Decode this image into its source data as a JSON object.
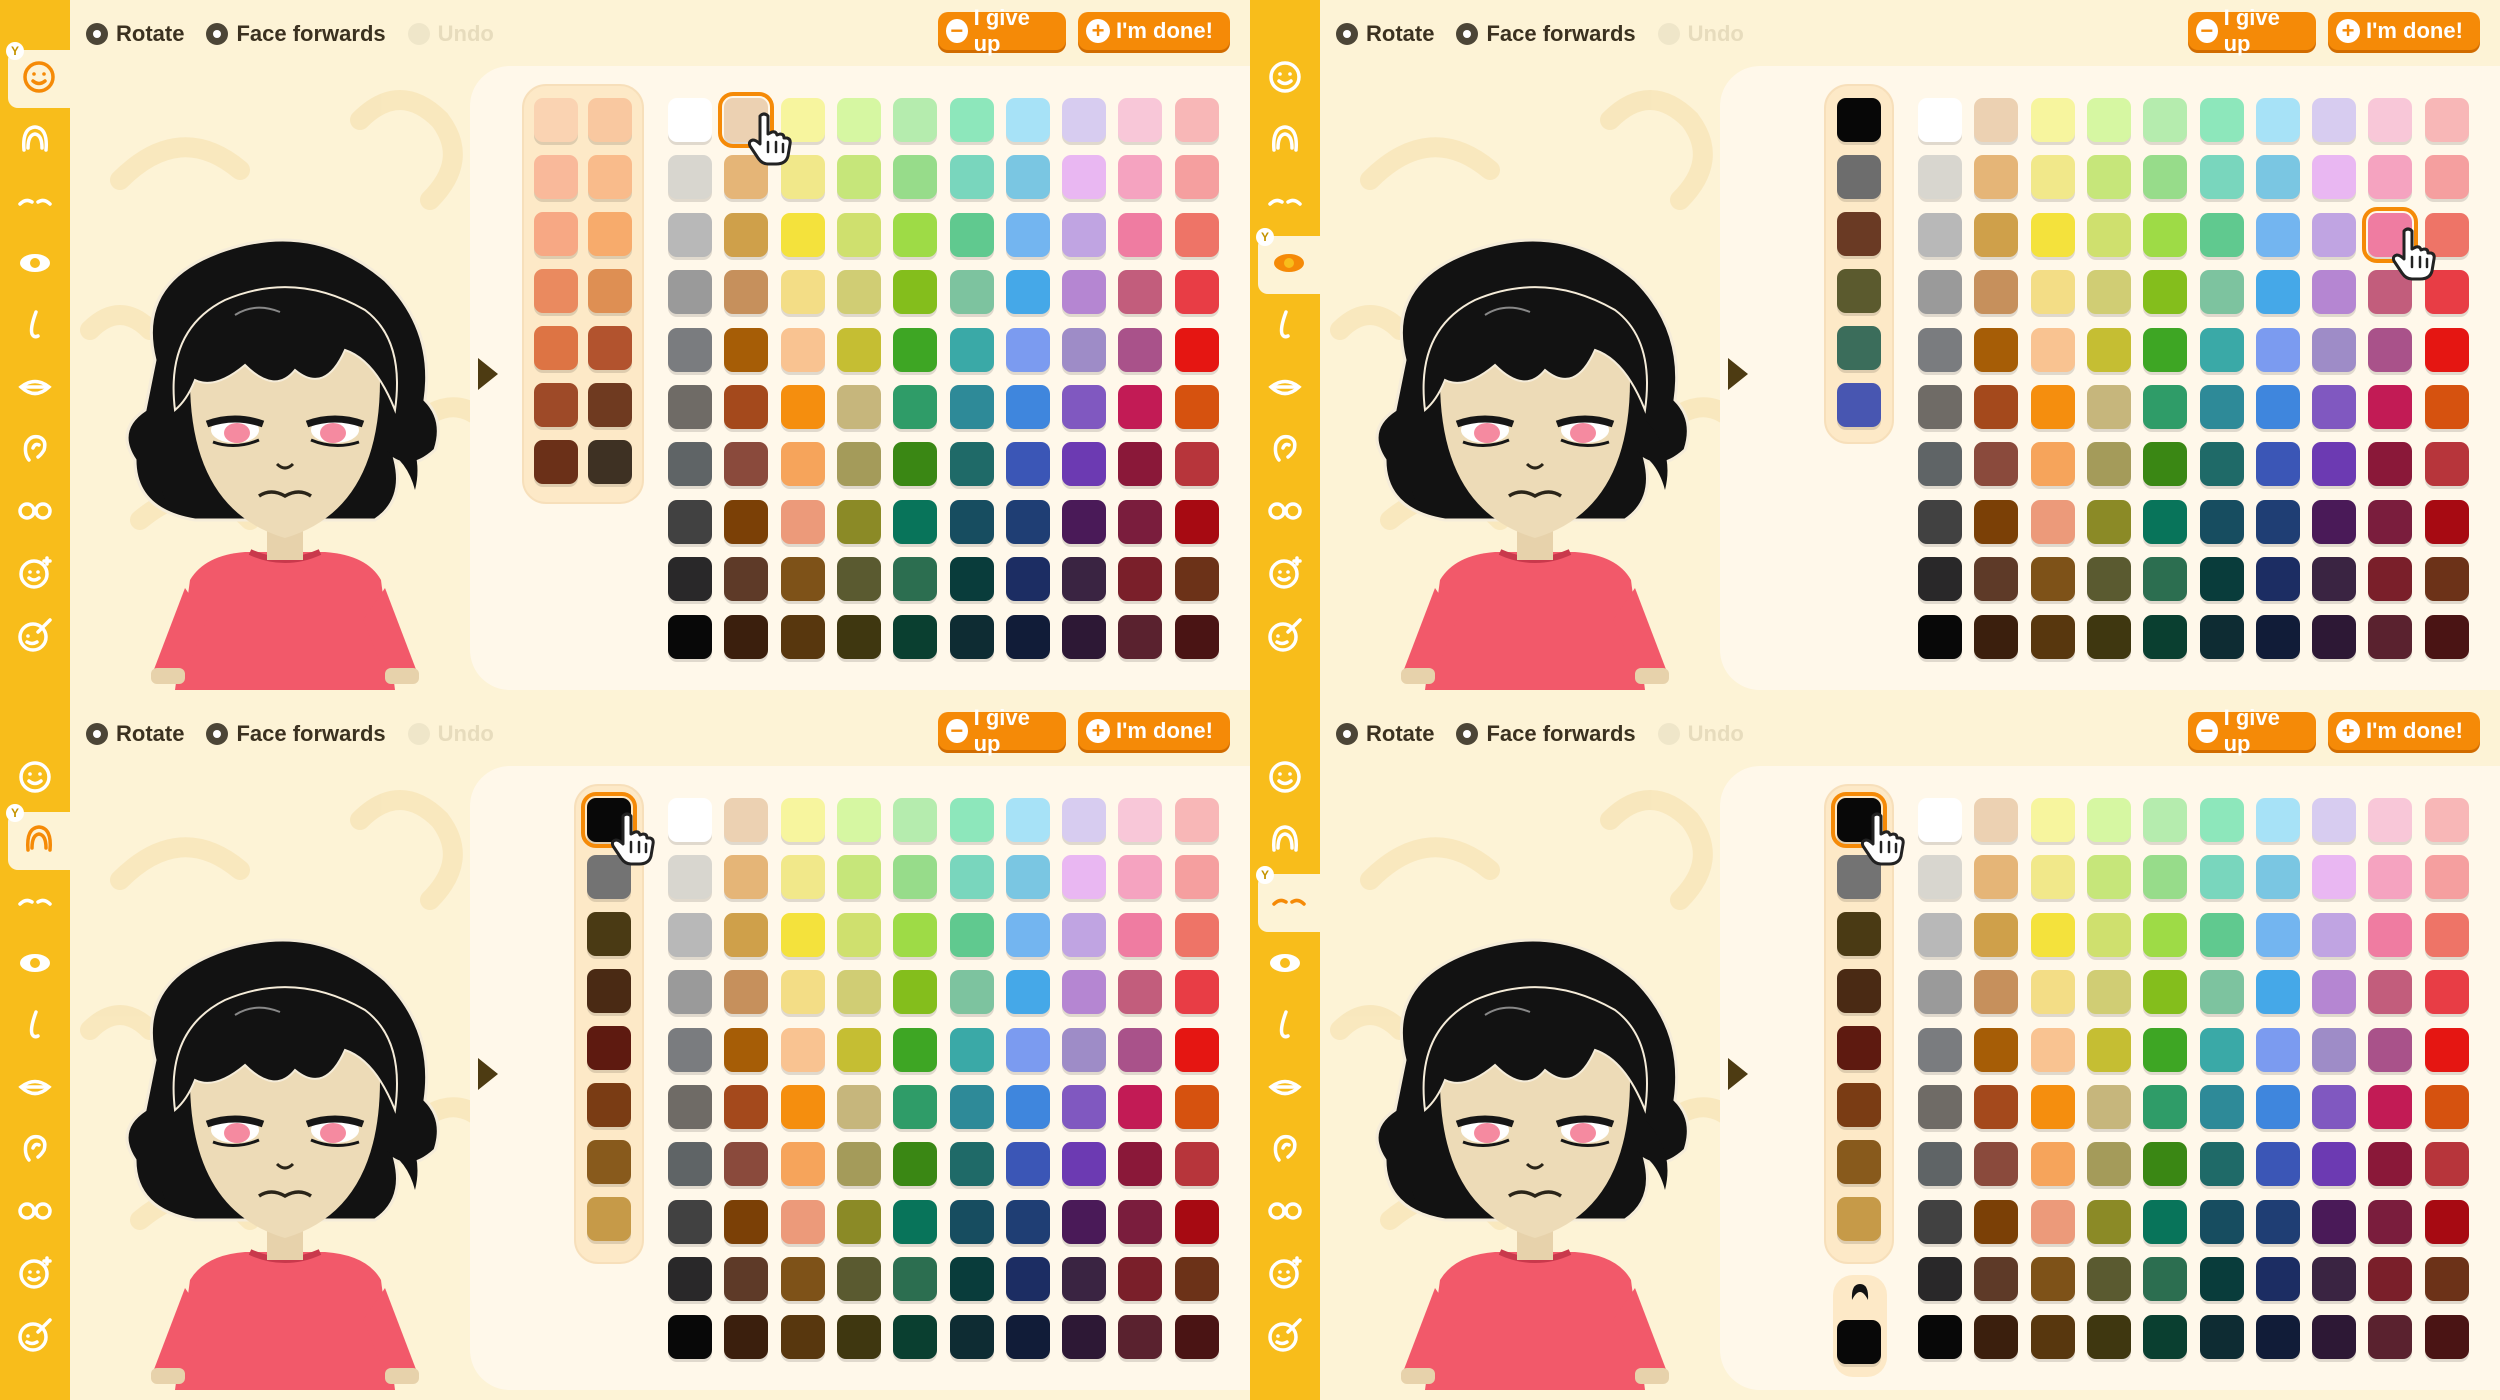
{
  "toolbar": {
    "rotate_label": "Rotate",
    "face_forwards_label": "Face forwards",
    "undo_label": "Undo",
    "give_up_label": "I give up",
    "done_label": "I'm done!"
  },
  "sidebar_icons": [
    "face-icon",
    "hair-icon",
    "eyebrows-icon",
    "eye-icon",
    "nose-icon",
    "mouth-icon",
    "ear-icon",
    "glasses-icon",
    "face-sparkle-icon",
    "makeup-icon"
  ],
  "panels": [
    {
      "active_tab": 0,
      "strip_type": "skin",
      "selected": {
        "area": "palette",
        "row": 0,
        "col": 1
      }
    },
    {
      "active_tab": 3,
      "strip_type": "eye",
      "selected": {
        "area": "palette",
        "row": 2,
        "col": 8
      }
    },
    {
      "active_tab": 1,
      "strip_type": "hair",
      "selected": {
        "area": "strip",
        "row": 0,
        "col": 0
      }
    },
    {
      "active_tab": 2,
      "strip_type": "hair",
      "selected": {
        "area": "strip",
        "row": 0,
        "col": 0
      },
      "extra_slot": true
    }
  ],
  "skin_strip": [
    [
      "#fad3b2",
      "#f9c8a0"
    ],
    [
      "#f9b99a",
      "#f9bb8b"
    ],
    [
      "#f7a884",
      "#f7ab6c"
    ],
    [
      "#ea8a5f",
      "#de8f53"
    ],
    [
      "#dd7444",
      "#b2532e"
    ],
    [
      "#9e4a28",
      "#6f3a20"
    ],
    [
      "#6b3018",
      "#3e3123"
    ]
  ],
  "eye_strip": [
    "#070707",
    "#6d6d6d",
    "#6a3a24",
    "#5b5a2e",
    "#3b6d5b",
    "#4856b1"
  ],
  "hair_strip": [
    "#080808",
    "#737373",
    "#4a3a14",
    "#4a2a14",
    "#5e1a10",
    "#7a3c14",
    "#885a1c",
    "#c69a48"
  ],
  "palette": [
    [
      "#ffffff",
      "#ecd1b2",
      "#f7f59e",
      "#d6f7a2",
      "#b5ecae",
      "#8de7bb",
      "#a7e2f7",
      "#d7ccf0",
      "#f8c7d8",
      "#f8b7b7"
    ],
    [
      "#d8d6cf",
      "#e5b577",
      "#f1e88a",
      "#c6e67a",
      "#97dc8a",
      "#79d6bd",
      "#7ac6e2",
      "#e9b7f2",
      "#f5a3c0",
      "#f59f9f"
    ],
    [
      "#b8b8b8",
      "#cfa04a",
      "#f4e23c",
      "#cfe06e",
      "#9edb46",
      "#60c98f",
      "#73b5f0",
      "#c0a4e2",
      "#ef7ca1",
      "#ee7467"
    ],
    [
      "#9a9a9a",
      "#c6905c",
      "#f3dd86",
      "#d0cd74",
      "#84be1c",
      "#7dc39f",
      "#45a8e8",
      "#b586d2",
      "#c25d7c",
      "#e83d45"
    ],
    [
      "#7a7c7f",
      "#a65d06",
      "#f9c391",
      "#c5be33",
      "#3ea624",
      "#3aa9a7",
      "#7b9bf0",
      "#9e8cc7",
      "#a9528a",
      "#e51612"
    ],
    [
      "#6f6b66",
      "#a4491c",
      "#f58e0e",
      "#c6b67c",
      "#2f9c68",
      "#2e8a98",
      "#3f86dd",
      "#8058c0",
      "#c21b55",
      "#d6520f"
    ],
    [
      "#5f6466",
      "#8a4a3c",
      "#f6a45b",
      "#a49b5a",
      "#3a8714",
      "#1f6a68",
      "#3b56b6",
      "#6c3ab2",
      "#8a1839",
      "#b7353b"
    ],
    [
      "#414141",
      "#7b4006",
      "#ec9a7a",
      "#8b8a26",
      "#08745a",
      "#174d60",
      "#1f3e74",
      "#4a1a58",
      "#7a1d3d",
      "#a70a12"
    ],
    [
      "#292829",
      "#5e3a28",
      "#7e5218",
      "#5a5a30",
      "#2c6e50",
      "#093c3b",
      "#1c2d63",
      "#3a2442",
      "#7a1f2a",
      "#6c3218"
    ],
    [
      "#080808",
      "#3b1f0d",
      "#58370e",
      "#3f3710",
      "#0a3f30",
      "#0e2c33",
      "#111c38",
      "#2d1835",
      "#5a222f",
      "#4a1414"
    ]
  ]
}
